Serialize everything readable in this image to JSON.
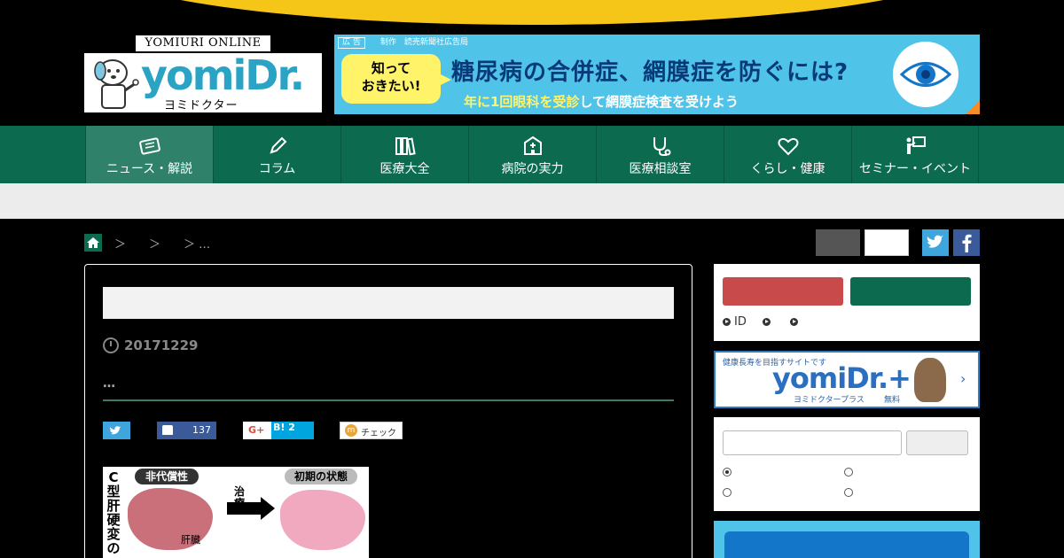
{
  "logo": {
    "online": "YOMIURI ONLINE",
    "brand": "yomiDr.",
    "brand_sub": "ヨミドクター"
  },
  "ad": {
    "tag": "広 告",
    "sponsor": "制作　読売新聞社広告局",
    "bubble_line1": "知って",
    "bubble_line2": "おきたい!",
    "headline": "糖尿病の合併症、網膜症を防ぐには?",
    "subline_highlight": "年に1回眼科を受診",
    "subline_rest": "して網膜症検査を受けよう"
  },
  "nav": {
    "items": [
      {
        "label": "ニュース・解説",
        "icon": "newspaper-icon"
      },
      {
        "label": "コラム",
        "icon": "pen-icon"
      },
      {
        "label": "医療大全",
        "icon": "books-icon"
      },
      {
        "label": "病院の実力",
        "icon": "hospital-icon"
      },
      {
        "label": "医療相談室",
        "icon": "stethoscope-icon"
      },
      {
        "label": "くらし・健康",
        "icon": "heart-icon"
      },
      {
        "label": "セミナー・イベント",
        "icon": "presenter-icon"
      }
    ]
  },
  "breadcrumb": {
    "sep1": "＞",
    "sep2": "＞",
    "sep3": "＞ …"
  },
  "article": {
    "date": "20171229",
    "subtitle": "…",
    "social": {
      "like_count": "137",
      "gplus": "G+",
      "hatena": "B! 2",
      "check": "チェック"
    },
    "figure": {
      "vertical_title": "C型肝硬変の",
      "label_left": "非代償性",
      "label_right": "初期の状態",
      "treatment": "治療",
      "organ": "肝臓"
    }
  },
  "sidebar": {
    "login_links": [
      "ID",
      "",
      ""
    ],
    "plus_banner": {
      "pre": "健康長寿を目指すサイトです",
      "brand": "yomiDr.+",
      "brand_sub": "ヨミドクタープラス",
      "free": "無料"
    }
  },
  "colors": {
    "nav_green": "#0c6b4f",
    "nav_active": "#2f8169",
    "accent_yellow": "#f5c518",
    "ad_blue": "#4fc3e8"
  }
}
